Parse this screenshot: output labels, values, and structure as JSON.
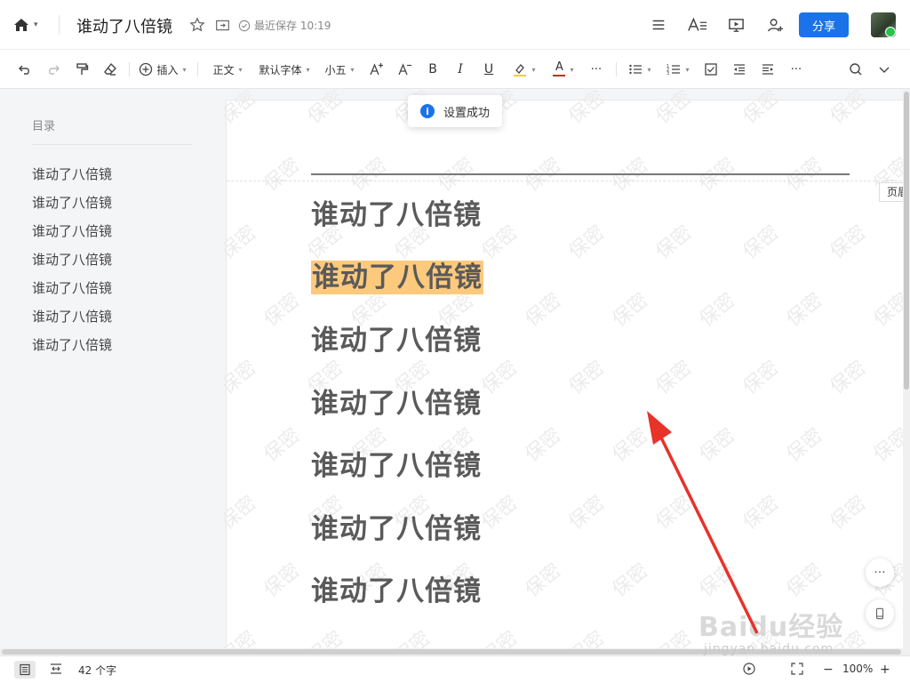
{
  "app": {
    "doc_title": "谁动了八倍镜",
    "save_status": "最近保存 10:19",
    "share_label": "分享"
  },
  "toolbar": {
    "insert_label": "插入",
    "style_label": "正文",
    "font_label": "默认字体",
    "size_label": "小五",
    "bold_glyph": "B",
    "italic_glyph": "I",
    "underline_glyph": "U",
    "font_color_glyph": "A",
    "more_glyph": "···"
  },
  "toast": {
    "message": "设置成功"
  },
  "sidebar": {
    "title": "目录",
    "items": [
      "谁动了八倍镜",
      "谁动了八倍镜",
      "谁动了八倍镜",
      "谁动了八倍镜",
      "谁动了八倍镜",
      "谁动了八倍镜",
      "谁动了八倍镜"
    ]
  },
  "document": {
    "headings": [
      "谁动了八倍镜",
      "谁动了八倍镜",
      "谁动了八倍镜",
      "谁动了八倍镜",
      "谁动了八倍镜",
      "谁动了八倍镜",
      "谁动了八倍镜"
    ],
    "highlighted_index": 1,
    "watermark_text": "保密",
    "header_tag": "页眉"
  },
  "statusbar": {
    "word_count": "42 个字",
    "zoom": "100%",
    "zoom_minus": "−",
    "zoom_plus": "+"
  },
  "overlay": {
    "baidu_logo": "Baidu经验",
    "baidu_url": "jingyan.baidu.com"
  },
  "colors": {
    "accent": "#1a73e8",
    "highlight": "#fdc97d",
    "annotation_arrow": "#e8322a"
  }
}
